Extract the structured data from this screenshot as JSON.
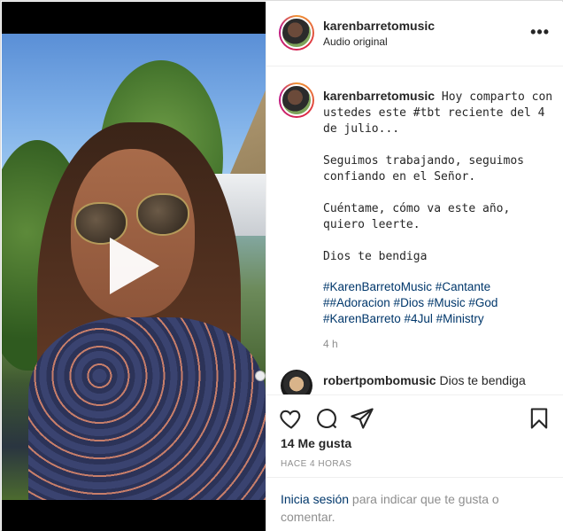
{
  "post": {
    "username": "karenbarretomusic",
    "audio": "Audio original",
    "more_label": "•••"
  },
  "caption": {
    "username": "karenbarretomusic",
    "text": " Hoy comparto con ustedes este #tbt reciente del 4 de julio...\n\nSeguimos trabajando, seguimos confiando en el Señor.\n\nCuéntame, cómo va este año, quiero leerte.\n\nDios te bendiga",
    "hashtags": "#KarenBarretoMusic #Cantante ##Adoracion #Dios #Music #God #KarenBarreto #4Jul #Ministry",
    "time": "4 h"
  },
  "comment": {
    "username": "robertpombomusic",
    "text": " Dios te bendiga"
  },
  "actions": {
    "like_icon": "heart-icon",
    "comment_icon": "comment-icon",
    "share_icon": "share-icon",
    "save_icon": "bookmark-icon"
  },
  "likes": "14 Me gusta",
  "posted_ago": "HACE 4 HORAS",
  "login": {
    "link": "Inicia sesión",
    "rest": " para indicar que te gusta o comentar."
  },
  "media": {
    "play_icon": "play-icon"
  }
}
